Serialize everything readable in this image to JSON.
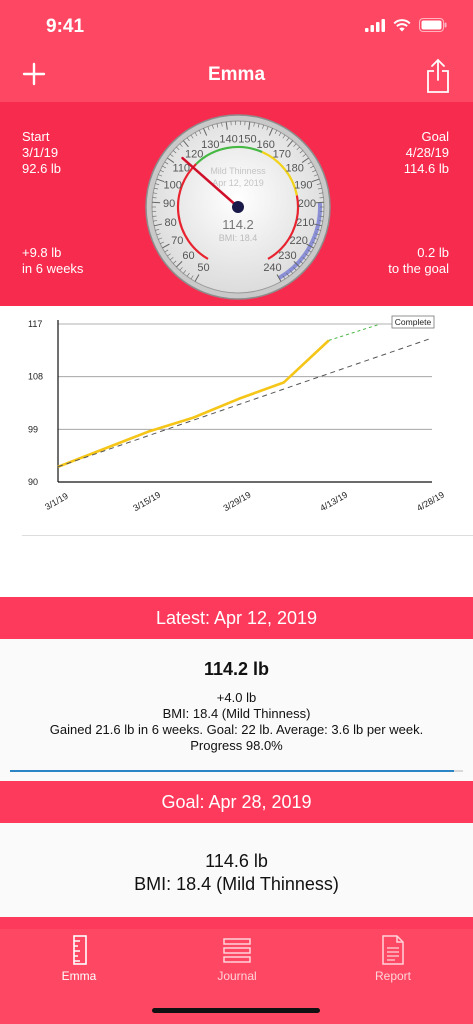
{
  "status_bar": {
    "time": "9:41"
  },
  "nav": {
    "title": "Emma",
    "add_icon": "plus-icon",
    "share_icon": "share-icon"
  },
  "hero": {
    "start_label": "Start",
    "start_date": "3/1/19",
    "start_weight": "92.6 lb",
    "goal_label": "Goal",
    "goal_date": "4/28/19",
    "goal_weight": "114.6 lb",
    "change": "+9.8 lb",
    "change_period": "in 6 weeks",
    "remaining": "0.2 lb",
    "remaining_caption": "to the goal"
  },
  "gauge": {
    "category": "Mild Thinness",
    "date": "Apr 12, 2019",
    "value": "114.2",
    "bmi": "BMI: 18.4",
    "needle_value": 114.2,
    "ticks": [
      "50",
      "60",
      "70",
      "80",
      "90",
      "100",
      "110",
      "120",
      "130",
      "140",
      "150",
      "160",
      "170",
      "180",
      "190",
      "200",
      "210",
      "220",
      "230",
      "240"
    ]
  },
  "chart_data": {
    "type": "line",
    "x_ticks": [
      "3/1/19",
      "3/15/19",
      "3/29/19",
      "4/13/19",
      "4/28/19"
    ],
    "y_ticks": [
      90,
      99,
      108,
      117
    ],
    "ylim": [
      90,
      117
    ],
    "badge": "Complete",
    "series": [
      {
        "x": [
          "3/1/19",
          "3/8/19",
          "3/15/19",
          "3/22/19",
          "3/29/19",
          "4/5/19",
          "4/12/19"
        ],
        "values": [
          92.6,
          95.6,
          98.6,
          101.0,
          104.2,
          107.0,
          114.2
        ]
      },
      {
        "x": [
          "3/1/19",
          "4/28/19"
        ],
        "values": [
          92.6,
          114.6
        ]
      },
      {
        "x": [
          "4/12/19",
          "4/20/19"
        ],
        "values": [
          114.2,
          117.0
        ]
      }
    ]
  },
  "latest": {
    "header": "Latest: Apr 12, 2019",
    "weight": "114.2 lb",
    "delta": "+4.0 lb",
    "bmi": "BMI: 18.4 (Mild Thinness)",
    "summary": "Gained 21.6 lb in 6 weeks. Goal: 22 lb. Average: 3.6 lb per week.",
    "progress_text": "Progress 98.0%",
    "progress_value": 0.98
  },
  "goal": {
    "header": "Goal: Apr 28, 2019",
    "weight": "114.6 lb",
    "bmi": "BMI: 18.4 (Mild Thinness)"
  },
  "tabs": [
    {
      "label": "Emma",
      "icon": "ruler-icon"
    },
    {
      "label": "Journal",
      "icon": "list-icon"
    },
    {
      "label": "Report",
      "icon": "document-icon"
    }
  ],
  "colors": {
    "header": "#fe4863",
    "hero": "#f72b4e",
    "accent_line": "#f5c518",
    "progress": "#2c86c6"
  }
}
